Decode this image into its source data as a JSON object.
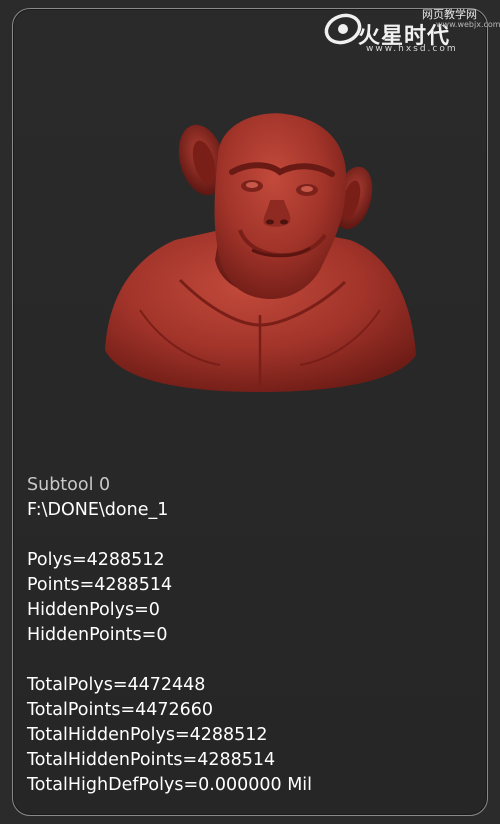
{
  "watermark": {
    "site_cn": "火星时代",
    "url": "www.hxsd.com",
    "corner_cn": "网页教学网",
    "corner_url": "www.webjx.com"
  },
  "subtool": {
    "title": "Subtool 0",
    "path": "F:\\DONE\\done_1"
  },
  "stats": {
    "polys": "Polys=4288512",
    "points": "Points=4288514",
    "hidden_polys": "HiddenPolys=0",
    "hidden_points": "HiddenPoints=0"
  },
  "totals": {
    "total_polys": "TotalPolys=4472448",
    "total_points": "TotalPoints=4472660",
    "total_hidden_polys": "TotalHiddenPolys=4288512",
    "total_hidden_points": "TotalHiddenPoints=4288514",
    "total_high_def_polys": "TotalHighDefPolys=0.000000 Mil"
  },
  "colors": {
    "background": "#2b2b2b",
    "panel_border": "#8a8a8a",
    "sculpt_red": "#a8352a",
    "text": "#ffffff"
  },
  "icons": {
    "thumbnail": "chimp-bust-sculpt",
    "watermark_logo": "hxsd-logo"
  }
}
